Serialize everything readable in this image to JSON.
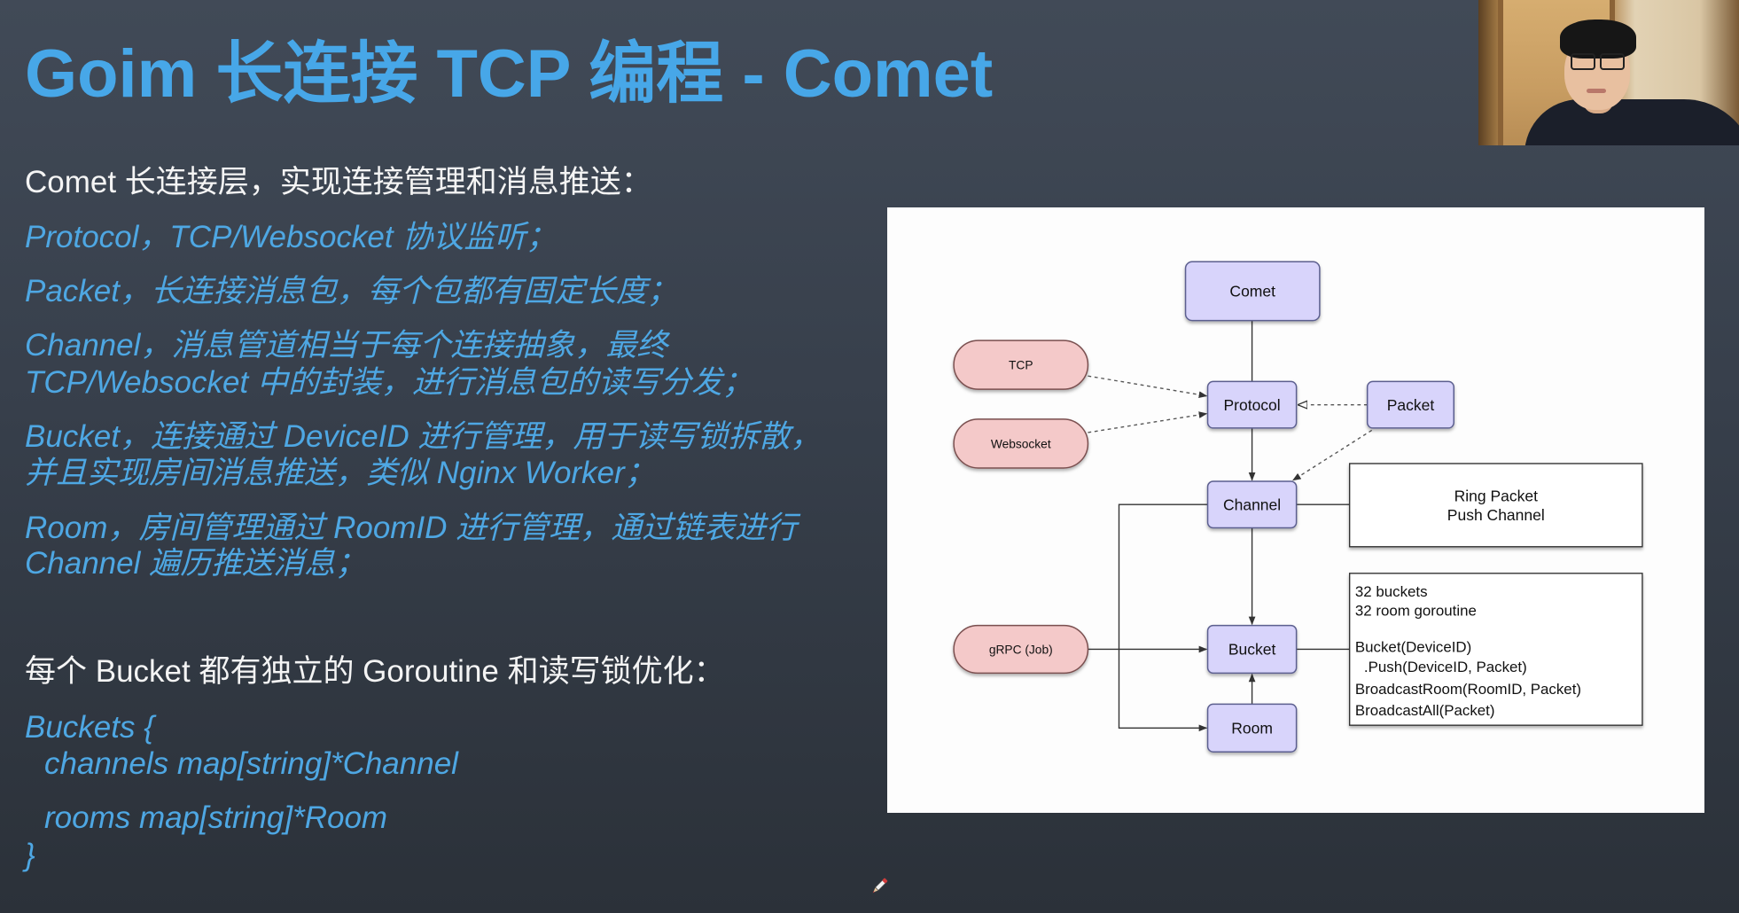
{
  "slide": {
    "title": "Goim 长连接 TCP 编程 - Comet",
    "intro": "Comet 长连接层，实现连接管理和消息推送：",
    "items": [
      {
        "lines": [
          "Protocol，TCP/Websocket 协议监听；"
        ]
      },
      {
        "lines": [
          "Packet，长连接消息包，每个包都有固定长度；"
        ]
      },
      {
        "lines": [
          "Channel，消息管道相当于每个连接抽象，最终",
          "TCP/Websocket 中的封装，进行消息包的读写分发；"
        ]
      },
      {
        "lines": [
          "Bucket，连接通过 DeviceID 进行管理，用于读写锁拆散，",
          "并且实现房间消息推送，类似 Nginx Worker；"
        ]
      },
      {
        "lines": [
          "Room，房间管理通过 RoomID 进行管理，通过链表进行",
          "Channel 遍历推送消息；"
        ]
      }
    ],
    "bucket_heading": "每个 Bucket 都有独立的 Goroutine 和读写锁优化：",
    "code": {
      "open": "Buckets {",
      "channels": "channels map[string]*Channel",
      "rooms": "rooms map[string]*Room",
      "close": "}"
    }
  },
  "diagram": {
    "nodes": {
      "comet": "Comet",
      "tcp": "TCP",
      "websocket": "Websocket",
      "protocol": "Protocol",
      "packet": "Packet",
      "channel": "Channel",
      "bucket": "Bucket",
      "grpc": "gRPC (Job)",
      "room": "Room"
    },
    "ring_note": [
      "Ring Packet",
      "Push Channel"
    ],
    "bucket_note": [
      "32 buckets",
      "32 room goroutine",
      "Bucket(DeviceID)",
      ".Push(DeviceID, Packet)",
      "BroadcastRoom(RoomID, Packet)",
      "BroadcastAll(Packet)"
    ]
  },
  "colors": {
    "title": "#47a7e8",
    "accent_text": "#4ea7e3",
    "body_text": "#f4f4f4",
    "background": "#394250",
    "node_fill": "#d8d4fb",
    "pill_fill": "#f4c9c9",
    "diagram_background": "#fdfdfd"
  },
  "icons": {
    "cursor": "pen-cursor-icon"
  }
}
